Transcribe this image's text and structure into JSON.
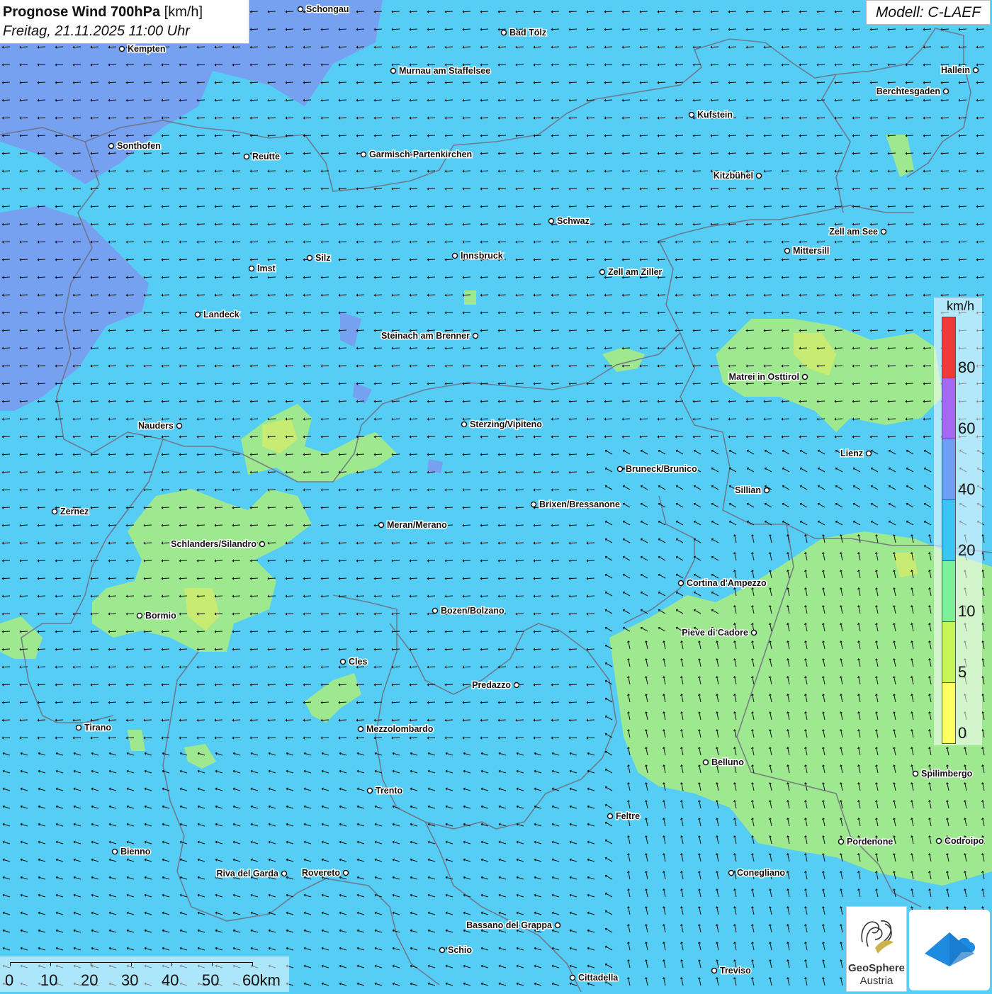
{
  "header": {
    "title": "Prognose Wind 700hPa",
    "unit": "[km/h]",
    "datetime": "Freitag, 21.11.2025 11:00 Uhr",
    "model": "Modell: C-LAEF"
  },
  "legend": {
    "unit": "km/h",
    "ticks": [
      "80",
      "60",
      "40",
      "20",
      "10",
      "5",
      "0"
    ],
    "colors": [
      "#f03a3a",
      "#a469f0",
      "#6f9ff2",
      "#39c6f5",
      "#7df09a",
      "#c6f55a",
      "#ffff66"
    ]
  },
  "scale_bar": {
    "labels": [
      "0",
      "10",
      "20",
      "30",
      "40",
      "50",
      "60km"
    ]
  },
  "colors": {
    "background_wind": "#56cdf4",
    "calm_zone": "#9ee88f",
    "calm_core": "#d6ec6a",
    "strong_zone": "#7a9cf0",
    "border_line": "#6e6e80"
  },
  "wind_field": {
    "default_direction": "toward west",
    "southeast_direction": "toward north-northwest"
  },
  "cities": [
    {
      "name": "Schongau"
    },
    {
      "name": "Bad Tölz"
    },
    {
      "name": "Kempten"
    },
    {
      "name": "Murnau am Staffelsee"
    },
    {
      "name": "Hallein"
    },
    {
      "name": "Berchtesgaden"
    },
    {
      "name": "Kufstein"
    },
    {
      "name": "Sonthofen"
    },
    {
      "name": "Reutte"
    },
    {
      "name": "Garmisch-Partenkirchen"
    },
    {
      "name": "Kitzbühel"
    },
    {
      "name": "Schwaz"
    },
    {
      "name": "Zell am See"
    },
    {
      "name": "Mittersill"
    },
    {
      "name": "Imst"
    },
    {
      "name": "Silz"
    },
    {
      "name": "Innsbruck"
    },
    {
      "name": "Zell am Ziller"
    },
    {
      "name": "Landeck"
    },
    {
      "name": "Steinach am Brenner"
    },
    {
      "name": "Matrei in Osttirol"
    },
    {
      "name": "Nauders"
    },
    {
      "name": "Sterzing/Vipiteno"
    },
    {
      "name": "Lienz"
    },
    {
      "name": "Bruneck/Brunico"
    },
    {
      "name": "Sillian"
    },
    {
      "name": "Brixen/Bressanone"
    },
    {
      "name": "Zernez"
    },
    {
      "name": "Meran/Merano"
    },
    {
      "name": "Schlanders/Silandro"
    },
    {
      "name": "Cortina d'Ampezzo"
    },
    {
      "name": "Bozen/Bolzano"
    },
    {
      "name": "Bormio"
    },
    {
      "name": "Pieve di Cadore"
    },
    {
      "name": "Cles"
    },
    {
      "name": "Predazzo"
    },
    {
      "name": "Tirano"
    },
    {
      "name": "Mezzolombardo"
    },
    {
      "name": "Belluno"
    },
    {
      "name": "Spilimbergo"
    },
    {
      "name": "Trento"
    },
    {
      "name": "Feltre"
    },
    {
      "name": "Pordenone"
    },
    {
      "name": "Codroipo"
    },
    {
      "name": "Bienno"
    },
    {
      "name": "Riva del Garda"
    },
    {
      "name": "Rovereto"
    },
    {
      "name": "Conegliano"
    },
    {
      "name": "Bassano del Grappa"
    },
    {
      "name": "Schio"
    },
    {
      "name": "Treviso"
    },
    {
      "name": "Cittadella"
    }
  ],
  "logos": {
    "geosphere_name": "GeoSphere",
    "geosphere_sub": "Austria"
  }
}
